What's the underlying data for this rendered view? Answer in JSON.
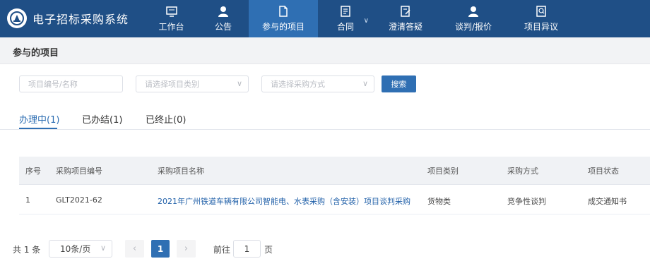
{
  "app": {
    "title": "电子招标采购系统"
  },
  "nav": {
    "workbench": "工作台",
    "notice": "公告",
    "projects": "参与的项目",
    "contract": "合同",
    "clarify": "澄清答疑",
    "negotiation": "谈判/报价",
    "dispute": "项目异议"
  },
  "page": {
    "title": "参与的项目"
  },
  "filters": {
    "code_placeholder": "项目编号/名称",
    "type_placeholder": "请选择项目类别",
    "method_placeholder": "请选择采购方式",
    "search_label": "搜索"
  },
  "tabs": {
    "doing": "办理中(1)",
    "done": "已办结(1)",
    "stopped": "已终止(0)"
  },
  "table": {
    "headers": {
      "index": "序号",
      "code": "采购项目编号",
      "name": "采购项目名称",
      "category": "项目类别",
      "method": "采购方式",
      "status": "项目状态"
    },
    "rows": [
      {
        "index": "1",
        "code": "GLT2021-62",
        "name": "2021年广州铁道车辆有限公司智能电、水表采购（含安装）项目谈判采购",
        "category": "货物类",
        "method": "竞争性谈判",
        "status": "成交通知书"
      }
    ]
  },
  "pagination": {
    "total": "共 1 条",
    "page_size": "10条/页",
    "current": "1",
    "goto_label": "前往",
    "goto_value": "1",
    "page_suffix": "页"
  },
  "colors": {
    "nav_bg": "#1f4f86",
    "nav_active": "#2f6fb3",
    "link": "#1f5fa8"
  }
}
